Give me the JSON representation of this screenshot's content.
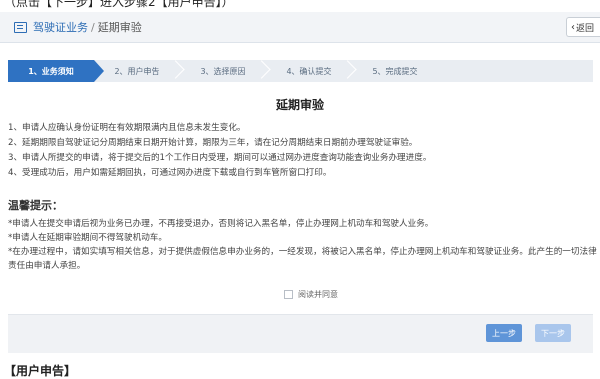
{
  "top_caption": "（点击【下一步】进入步骤2【用户申告】）",
  "header": {
    "breadcrumb_root": "驾驶证业务",
    "breadcrumb_separator": "/",
    "breadcrumb_leaf": "延期审验",
    "back_label": "返回"
  },
  "steps": [
    {
      "label": "1、业务须知",
      "active": true
    },
    {
      "label": "2、用户申告",
      "active": false
    },
    {
      "label": "3、选择原因",
      "active": false
    },
    {
      "label": "4、确认提交",
      "active": false
    },
    {
      "label": "5、完成提交",
      "active": false
    }
  ],
  "title": "延期审验",
  "rules": [
    "1、申请人应确认身份证明在有效期限满内且信息未发生变化。",
    "2、延期期限自驾驶证记分周期结束日期开始计算，期限为三年，请在记分周期结束日期前办理驾驶证审验。",
    "3、申请人所提交的申请，将于提交后的1个工作日内受理，期间可以通过网办进度查询功能查询业务办理进度。",
    "4、受理成功后，用户如需延期回执，可通过网办进度下载或自行到车管所窗口打印。"
  ],
  "tips_title": "温馨提示：",
  "tips": [
    "*申请人在提交申请后视为业务已办理，不再接受退办，否则将记入黑名单，停止办理网上机动车和驾驶人业务。",
    "*申请人在延期审验期间不得驾驶机动车。",
    "*在办理过程中，请如实填写相关信息，对于提供虚假信息申办业务的，一经发现，将被记入黑名单，停止办理网上机动车和驾驶证业务。此产生的一切法律责任由申请人承担。"
  ],
  "agree_label": "阅读并同意",
  "buttons": {
    "prev": "上一步",
    "next": "下一步"
  },
  "bottom_caption": "【用户申告】",
  "colors": {
    "accent": "#2f72c2",
    "step_bg": "#e9edf2",
    "prev_btn": "#5f95d8",
    "next_btn_disabled": "#a9c6ec"
  }
}
